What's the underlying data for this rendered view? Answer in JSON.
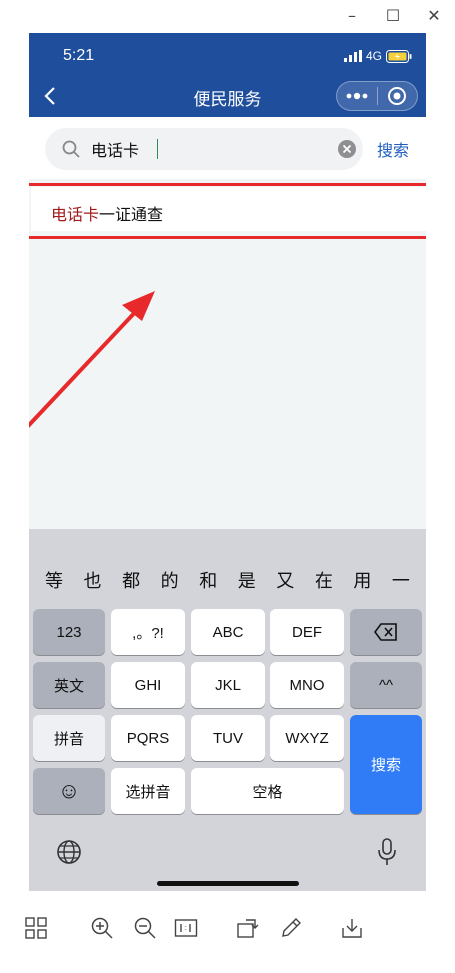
{
  "window": {
    "minimize": "–",
    "maximize": "☐",
    "close": "✕"
  },
  "status": {
    "time": "5:21",
    "network": "4G"
  },
  "header": {
    "title": "便民服务",
    "back_icon": "chevron-left-icon",
    "more_icon": "more-dots-icon",
    "target_icon": "target-icon"
  },
  "search": {
    "value": "电话卡",
    "placeholder": "",
    "button": "搜索"
  },
  "result": {
    "highlight": "电话卡",
    "rest": "一证通查"
  },
  "candidates": [
    "等",
    "也",
    "都",
    "的",
    "和",
    "是",
    "又",
    "在",
    "用",
    "一"
  ],
  "keys": {
    "row1": [
      "123",
      ",。?!",
      "ABC",
      "DEF"
    ],
    "row2": [
      "英文",
      "GHI",
      "JKL",
      "MNO",
      "^^"
    ],
    "row3": [
      "拼音",
      "PQRS",
      "TUV",
      "WXYZ"
    ],
    "row4_left": "☺",
    "row4_pinyin": "选拼音",
    "row4_space": "空格",
    "search": "搜索"
  },
  "colors": {
    "header": "#1f4e9c",
    "accent_blue": "#2f7cf6",
    "highlight_red": "#a21a1a",
    "annotation_red": "#e8292b"
  }
}
